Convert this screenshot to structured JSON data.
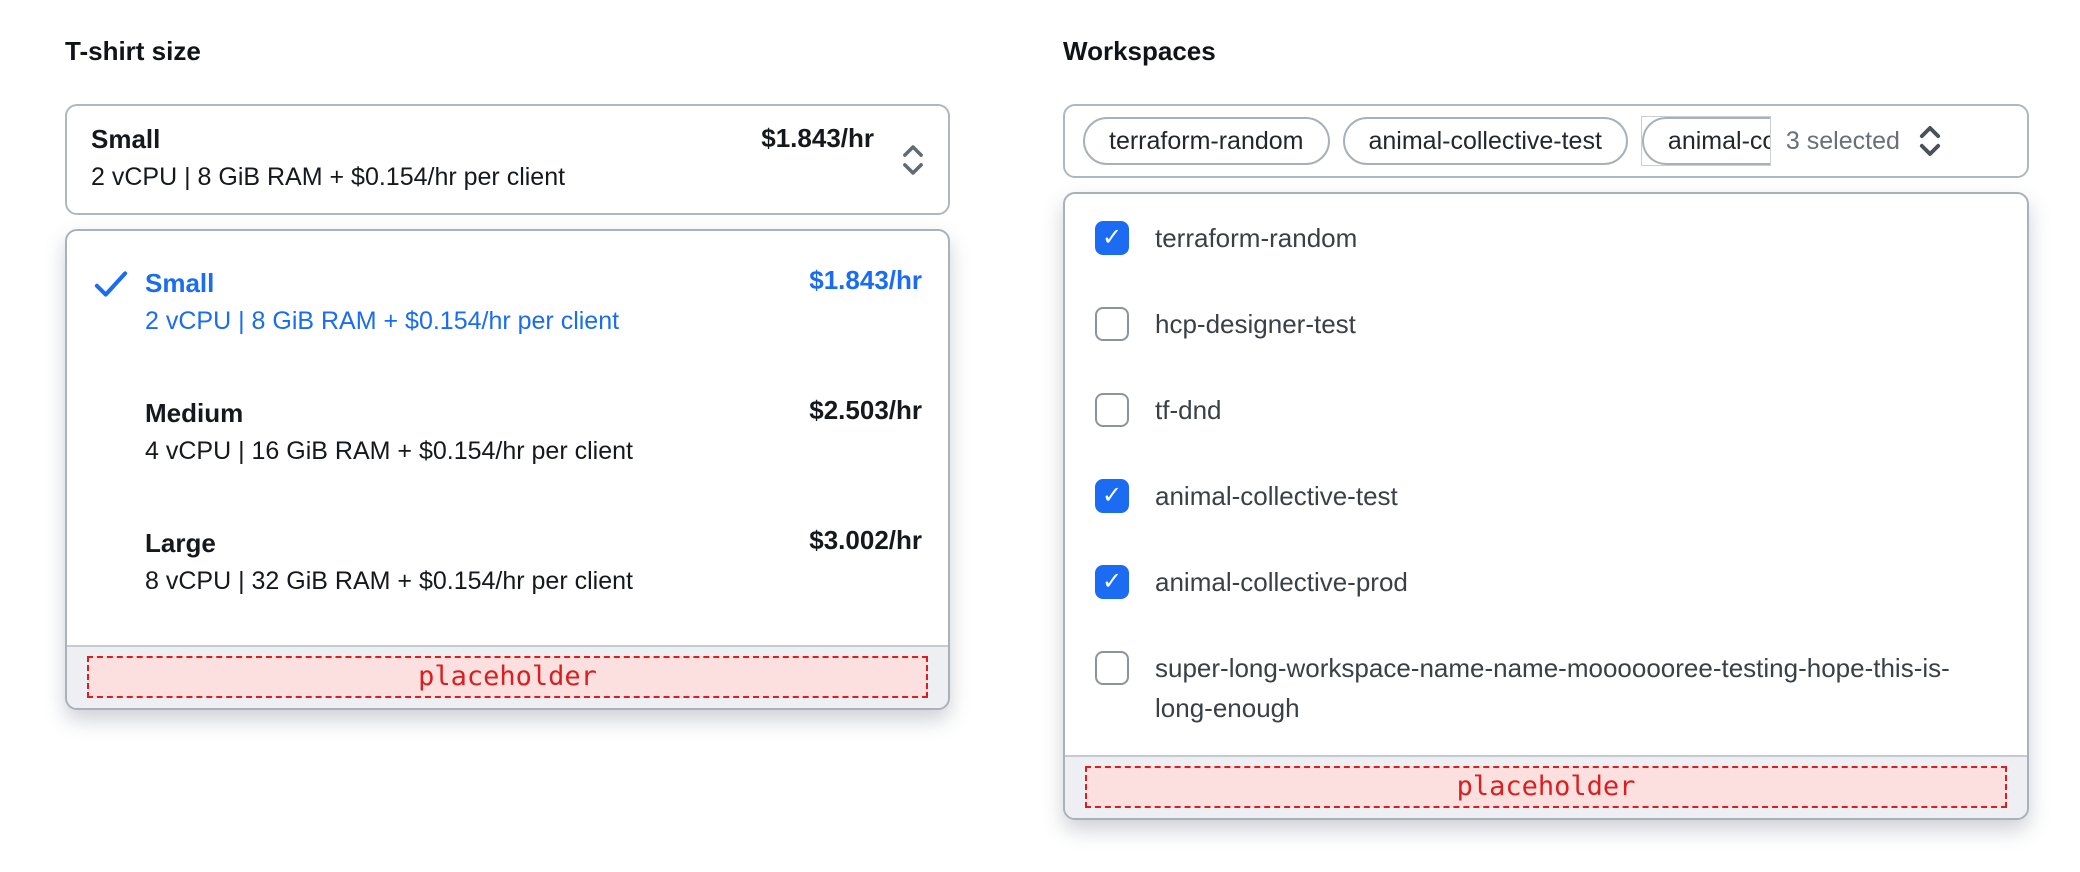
{
  "tshirt": {
    "label": "T-shirt size",
    "trigger": {
      "title": "Small",
      "description": "2 vCPU | 8 GiB RAM + $0.154/hr per client",
      "price": "$1.843/hr"
    },
    "options": [
      {
        "title": "Small",
        "description": "2 vCPU | 8 GiB RAM + $0.154/hr per client",
        "price": "$1.843/hr",
        "selected": true
      },
      {
        "title": "Medium",
        "description": "4 vCPU | 16 GiB RAM + $0.154/hr per client",
        "price": "$2.503/hr",
        "selected": false
      },
      {
        "title": "Large",
        "description": "8 vCPU | 32 GiB RAM + $0.154/hr per client",
        "price": "$3.002/hr",
        "selected": false
      }
    ],
    "footer_placeholder": "placeholder"
  },
  "workspaces": {
    "label": "Workspaces",
    "trigger": {
      "tags": [
        "terraform-random",
        "animal-collective-test",
        "animal-collective-prod"
      ],
      "selected_count_label": "3 selected"
    },
    "options": [
      {
        "label": "terraform-random",
        "checked": true
      },
      {
        "label": "hcp-designer-test",
        "checked": false
      },
      {
        "label": "tf-dnd",
        "checked": false
      },
      {
        "label": "animal-collective-test",
        "checked": true
      },
      {
        "label": "animal-collective-prod",
        "checked": true
      },
      {
        "label": "super-long-workspace-name-name-mooooooree-testing-hope-this-is-long-enough",
        "checked": false
      }
    ],
    "footer_placeholder": "placeholder"
  },
  "colors": {
    "accent": "#1a6cf2",
    "checkbox": "#1b6cf2",
    "placeholder_red": "#d92020",
    "placeholder_bg": "#fcdfdf"
  }
}
